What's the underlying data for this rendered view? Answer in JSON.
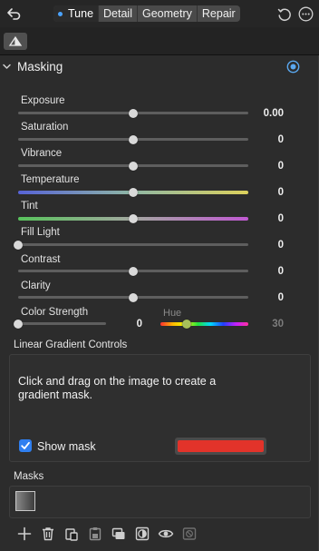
{
  "topbar": {
    "tabs": [
      {
        "label": "Tune",
        "active": true
      },
      {
        "label": "Detail",
        "active": false
      },
      {
        "label": "Geometry",
        "active": false
      },
      {
        "label": "Repair",
        "active": false
      }
    ],
    "accent_color": "#4aa3ff"
  },
  "panel": {
    "title": "Masking",
    "sliders": [
      {
        "label": "Exposure",
        "value": "0.00",
        "position": 0.5
      },
      {
        "label": "Saturation",
        "value": "0",
        "position": 0.5
      },
      {
        "label": "Vibrance",
        "value": "0",
        "position": 0.5
      },
      {
        "label": "Temperature",
        "value": "0",
        "position": 0.5
      },
      {
        "label": "Tint",
        "value": "0",
        "position": 0.5
      },
      {
        "label": "Fill Light",
        "value": "0",
        "position": 0.0
      },
      {
        "label": "Contrast",
        "value": "0",
        "position": 0.5
      },
      {
        "label": "Clarity",
        "value": "0",
        "position": 0.5
      }
    ],
    "color_strength": {
      "label": "Color Strength",
      "value": "0",
      "position": 0.0
    },
    "hue": {
      "label": "Hue",
      "value": "30",
      "position": 0.3
    }
  },
  "linear_gradient": {
    "title": "Linear Gradient Controls",
    "instructions": "Click and drag on the image to create a gradient mask.",
    "show_mask_label": "Show mask",
    "show_mask_checked": true,
    "mask_color": "#e2332a"
  },
  "masks": {
    "title": "Masks"
  },
  "bottom_toolbar": {
    "icons": [
      "add-icon",
      "trash-icon",
      "copy-icon",
      "paste-icon",
      "duplicate-icon",
      "invert-icon",
      "eye-icon",
      "clear-mask-icon"
    ]
  }
}
